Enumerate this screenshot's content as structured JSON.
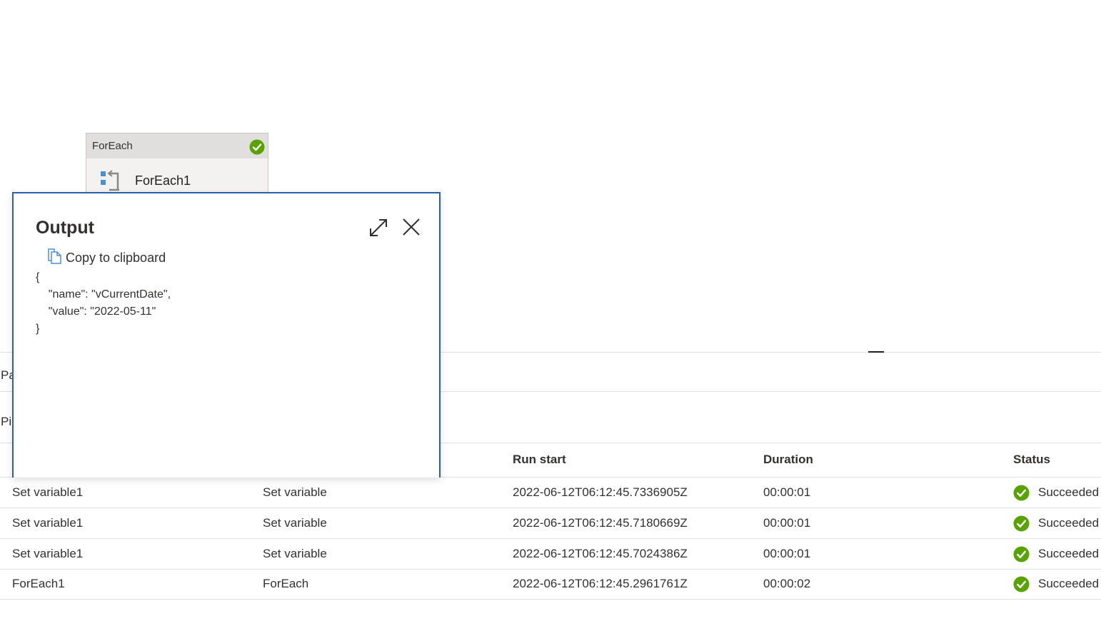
{
  "activity_node": {
    "type_label": "ForEach",
    "name": "ForEach1",
    "status": "succeeded"
  },
  "background_labels": {
    "truncated_tab": "Pa",
    "truncated_section": "Pi"
  },
  "table": {
    "headers": {
      "run_start": "Run start",
      "duration": "Duration",
      "status": "Status"
    },
    "rows": [
      {
        "name": "Set variable1",
        "type": "Set variable",
        "run_start": "2022-06-12T06:12:45.7336905Z",
        "duration": "00:00:01",
        "status": "Succeeded"
      },
      {
        "name": "Set variable1",
        "type": "Set variable",
        "run_start": "2022-06-12T06:12:45.7180669Z",
        "duration": "00:00:01",
        "status": "Succeeded"
      },
      {
        "name": "Set variable1",
        "type": "Set variable",
        "run_start": "2022-06-12T06:12:45.7024386Z",
        "duration": "00:00:01",
        "status": "Succeeded"
      },
      {
        "name": "ForEach1",
        "type": "ForEach",
        "run_start": "2022-06-12T06:12:45.2961761Z",
        "duration": "00:00:02",
        "status": "Succeeded"
      }
    ]
  },
  "output_dialog": {
    "title": "Output",
    "copy_label": "Copy to clipboard",
    "json_text": "{\n    \"name\": \"vCurrentDate\",\n    \"value\": \"2022-05-11\"\n}"
  },
  "icons": {
    "success": "check-circle-icon",
    "foreach": "foreach-icon",
    "expand": "expand-icon",
    "close": "close-icon",
    "copy": "copy-icon"
  },
  "colors": {
    "success_green": "#57a300",
    "dialog_border": "#2b5fb3",
    "icon_blue": "#4a90d9"
  }
}
